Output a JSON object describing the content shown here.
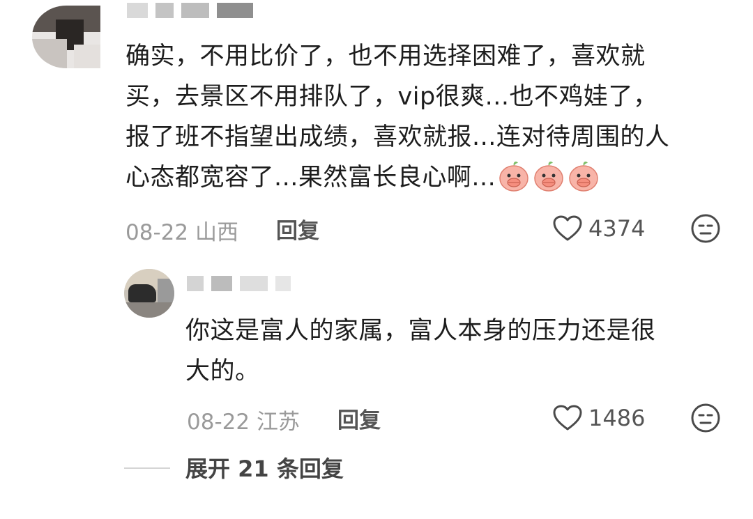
{
  "comment": {
    "author": "",
    "text_lines": [
      "确实，不用比价了，也不用选择困难了，喜欢就",
      "买，去景区不用排队了，vip很爽...也不鸡娃了，",
      "报了班不指望出成绩，喜欢就报...连对待周围的人",
      "心态都宽容了...果然富长良心啊..."
    ],
    "emoji_icons": [
      "peach-covering-mouth-icon",
      "peach-covering-mouth-icon",
      "peach-covering-mouth-icon"
    ],
    "date": "08-22",
    "location": "山西",
    "reply_label": "回复",
    "like_count": "4374"
  },
  "reply": {
    "author": "",
    "text_lines": [
      "你这是富人的家属，富人本身的压力还是很",
      "大的。"
    ],
    "date": "08-22",
    "location": "江苏",
    "reply_label": "回复",
    "like_count": "1486"
  },
  "expand": {
    "label": "展开 21 条回复"
  },
  "colors": {
    "text": "#1d1d1d",
    "meta": "#9a9a9a",
    "icon": "#4a4a4a",
    "peach": "#f4a59a"
  }
}
